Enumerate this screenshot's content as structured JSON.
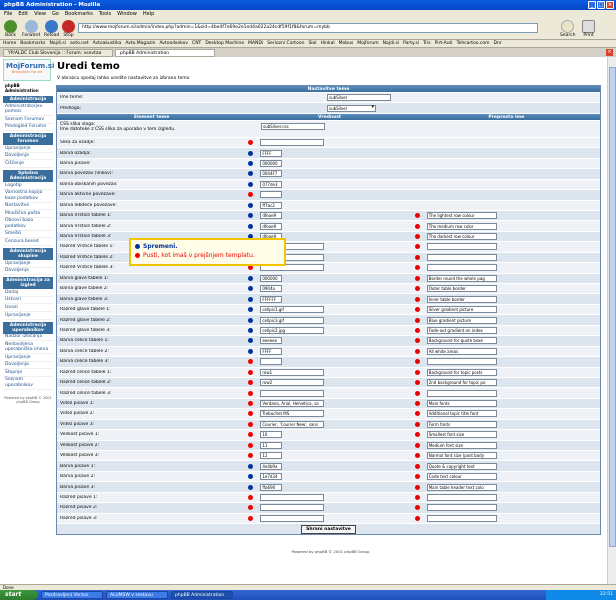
{
  "window": {
    "title": "phpBB Administration - Mozilla"
  },
  "menu": [
    "File",
    "Edit",
    "View",
    "Go",
    "Bookmarks",
    "Tools",
    "Window",
    "Help"
  ],
  "toolbar": {
    "back": "Back",
    "forward": "Forward",
    "reload": "Reload",
    "stop": "Stop",
    "search": "Search",
    "print": "Print",
    "url": "http://www.mojforum.si/admin/index.php?admin=1&sid=4be4f7e69e2e1ed4a022a24cdf59f1f8&forum=mybb"
  },
  "bookmarks": [
    "Home",
    "Bookmarks",
    "Najdi.si",
    "avto.net",
    "Avtoakustika",
    "Avto.Magazin",
    "Avtoodsekov",
    "CNT",
    "Desktop Machine",
    "MANDi",
    "Seriozni Cartoon",
    "Siol",
    "Hinkal",
    "Mobus",
    "Mojforum",
    "Najdi.si",
    "Party.si",
    "Tris",
    "Pirt-Auti",
    "Tehcartoo.com",
    "Dnr"
  ],
  "tabs": [
    "YP/ALDC Club Slovenija :: Forum: vsevtaa",
    "phpBB Administration"
  ],
  "sidebar": {
    "logo_main": "MojForum.si",
    "logo_sub": "Brezplačni Forum",
    "admin_link": "phpBB Administration",
    "sections": [
      {
        "head": "Administracija",
        "items": [
          "Administratorjev pomoci",
          "Seznam Forumov",
          "Predogled Foruma"
        ]
      },
      {
        "head": "Administracija forumov",
        "items": [
          "Upravljanje",
          "Dovoljenja",
          "Čiščenje"
        ]
      },
      {
        "head": "Splošna Administracija",
        "items": [
          "Logotip",
          "Varnostna kopija baze podatkov",
          "Nastavitve",
          "Množična pošta",
          "Obnovi bazo podatkov",
          "Smeški",
          "Cenzura besed"
        ]
      },
      {
        "head": "Administracija skupine",
        "items": [
          "Upravljanje",
          "Dovoljenja"
        ]
      },
      {
        "head": "Administracija za izgled",
        "items": [
          "Dodaj",
          "Ustvari",
          "Izvozi",
          "Upravljanje"
        ]
      },
      {
        "head": "Administracija uporabnikov",
        "items": [
          "Nadzor izločanja",
          "Nedovoljena uporabniška imena",
          "Upravljanje",
          "Dovoljenja",
          "Stopnje",
          "Seznam uporabnikov"
        ]
      }
    ],
    "powered": "Powered by phpBB © 2001 phpBB Group"
  },
  "page": {
    "title": "Uredi temo",
    "desc": "V obrazcu spodaj lahko uredite nastavitve za izbrano temo",
    "header": "Nastavitve teme",
    "theme_name_label": "Ime teme:",
    "theme_name_value": "subSilver",
    "template_label": "Predloga:",
    "template_value": "subSilver",
    "col_element": "Element teme",
    "col_value": "Vrednost",
    "col_name": "Preprosto ime",
    "css_label": "CSS slika sloga:",
    "css_desc": "Ime datoteke z CSS sliko za uporabo v tem izgledu.",
    "css_value": "subSilver.css",
    "save": "Shrani nastavitve",
    "footer": "Powered by phpBB © 2001 phpBB Group"
  },
  "legend": {
    "blue": "Spremeni.",
    "red": "Pusti, kot imaš v prejšnjem templatu."
  },
  "colors": {
    "blue_dot": "#003399",
    "red_dot": "#e00000"
  },
  "rows": [
    {
      "label": "Slika za ozadje:",
      "dot": "red",
      "value": "",
      "w": "w60",
      "hint": null
    },
    {
      "label": "Barva ozadja:",
      "dot": "blue",
      "value": "FFFF",
      "w": "w30",
      "hint": null
    },
    {
      "label": "Barva pisave:",
      "dot": "blue",
      "value": "000000",
      "w": "w30",
      "hint": null
    },
    {
      "label": "Barva povezav (linkov):",
      "dot": "blue",
      "value": "0044F7",
      "w": "w30",
      "hint": null
    },
    {
      "label": "Barva obiskanih povezav:",
      "dot": "blue",
      "value": "077de3",
      "w": "w30",
      "hint": null
    },
    {
      "label": "Barva aktivne povezave:",
      "dot": "red",
      "value": "",
      "w": "w30",
      "hint": null
    },
    {
      "label": "Barva lebdeče povezave:",
      "dot": "blue",
      "value": "ff7ac2",
      "w": "w30",
      "hint": null
    },
    {
      "label": "Barva Vrstice tabele 1:",
      "dot": "blue",
      "value": "dfeae9",
      "w": "w30",
      "hint": "The lightest row colour"
    },
    {
      "label": "Barva Vrstice tabele 2:",
      "dot": "blue",
      "value": "dfeae9",
      "w": "w30",
      "hint": "The medium row color"
    },
    {
      "label": "Barva Vrstice tabele 3:",
      "dot": "blue",
      "value": "dfeae9",
      "w": "w30",
      "hint": "The darkest row colour"
    },
    {
      "label": "Razred Vrstice tabele 1:",
      "dot": "red",
      "value": "",
      "w": "w60",
      "hint": ""
    },
    {
      "label": "Razred Vrstice tabele 2:",
      "dot": "red",
      "value": "",
      "w": "w60",
      "hint": ""
    },
    {
      "label": "Razred Vrstice tabele 3:",
      "dot": "red",
      "value": "",
      "w": "w60",
      "hint": ""
    },
    {
      "label": "Barva glave tabele 1:",
      "dot": "blue",
      "value": "000000",
      "w": "w30",
      "hint": "Border round the whole pag"
    },
    {
      "label": "Barva glave tabele 2:",
      "dot": "blue",
      "value": "0904a",
      "w": "w30",
      "hint": "Outer table border"
    },
    {
      "label": "Barva glave tabele 3:",
      "dot": "blue",
      "value": "FFFFFF",
      "w": "w30",
      "hint": "Inner table border"
    },
    {
      "label": "Razred glave tabele 1:",
      "dot": "blue",
      "value": "cellpic1.gif",
      "w": "w60",
      "hint": "Silver gradient picture"
    },
    {
      "label": "Razred glave tabele 2:",
      "dot": "blue",
      "value": "cellpic3.gif",
      "w": "w60",
      "hint": "Blue gradient picture"
    },
    {
      "label": "Razred glave tabele 3:",
      "dot": "blue",
      "value": "cellpic2.jpg",
      "w": "w60",
      "hint": "Fade-out gradient on index"
    },
    {
      "label": "Barva celice tabele 1:",
      "dot": "blue",
      "value": "eeeeee",
      "w": "w30",
      "hint": "Background for quote boxe"
    },
    {
      "label": "Barva celice tabele 2:",
      "dot": "blue",
      "value": "FFFF",
      "w": "w30",
      "hint": "All white areas"
    },
    {
      "label": "Barva celice tabele 3:",
      "dot": "red",
      "value": "",
      "w": "w30",
      "hint": ""
    },
    {
      "label": "Razred celice tabele 1:",
      "dot": "red",
      "value": "row1",
      "w": "w60",
      "hint": "Background for topic posts"
    },
    {
      "label": "Razred celice tabele 2:",
      "dot": "red",
      "value": "row2",
      "w": "w60",
      "hint": "2nd background for topic po"
    },
    {
      "label": "Razred celice tabele 3:",
      "dot": "red",
      "value": "",
      "w": "w60",
      "hint": ""
    },
    {
      "label": "Videz pisave 1:",
      "dot": "red",
      "value": "Verdana, Arial, Helvetica, sa",
      "w": "w60",
      "hint": "Main fonts"
    },
    {
      "label": "Videz pisave 2:",
      "dot": "red",
      "value": "Trebuchet MS",
      "w": "w60",
      "hint": "Additional topic title font"
    },
    {
      "label": "Videz pisave 3:",
      "dot": "red",
      "value": "Courier, 'Courier New', sans",
      "w": "w60",
      "hint": "Form fonts"
    },
    {
      "label": "Velikost pisave 1:",
      "dot": "red",
      "value": "10",
      "w": "w30",
      "hint": "Smallest font size"
    },
    {
      "label": "Velikost pisave 2:",
      "dot": "red",
      "value": "11",
      "w": "w30",
      "hint": "Medium font size"
    },
    {
      "label": "Velikost pisave 3:",
      "dot": "red",
      "value": "12",
      "w": "w30",
      "hint": "Normal font size (post body"
    },
    {
      "label": "Barva pisave 1:",
      "dot": "blue",
      "value": "4e4b9a",
      "w": "w30",
      "hint": "Quote & copyright text"
    },
    {
      "label": "Barva pisave 2:",
      "dot": "blue",
      "value": "1e7d34",
      "w": "w30",
      "hint": "Code text colour"
    },
    {
      "label": "Barva pisave 3:",
      "dot": "blue",
      "value": "ffa690",
      "w": "w30",
      "hint": "Main table header text colo"
    },
    {
      "label": "Razred pisave 1:",
      "dot": "red",
      "value": "",
      "w": "w60",
      "hint": ""
    },
    {
      "label": "Razred pisave 2:",
      "dot": "red",
      "value": "",
      "w": "w60",
      "hint": ""
    },
    {
      "label": "Razred pisave 3:",
      "dot": "red",
      "value": "",
      "w": "w60",
      "hint": ""
    }
  ],
  "status": "Done",
  "taskbar": {
    "start": "start",
    "tasks": [
      "Pozdravljeni Verzus",
      "ALUMSW v sestavu",
      "phpBB Administration"
    ],
    "clock": "22:51"
  }
}
